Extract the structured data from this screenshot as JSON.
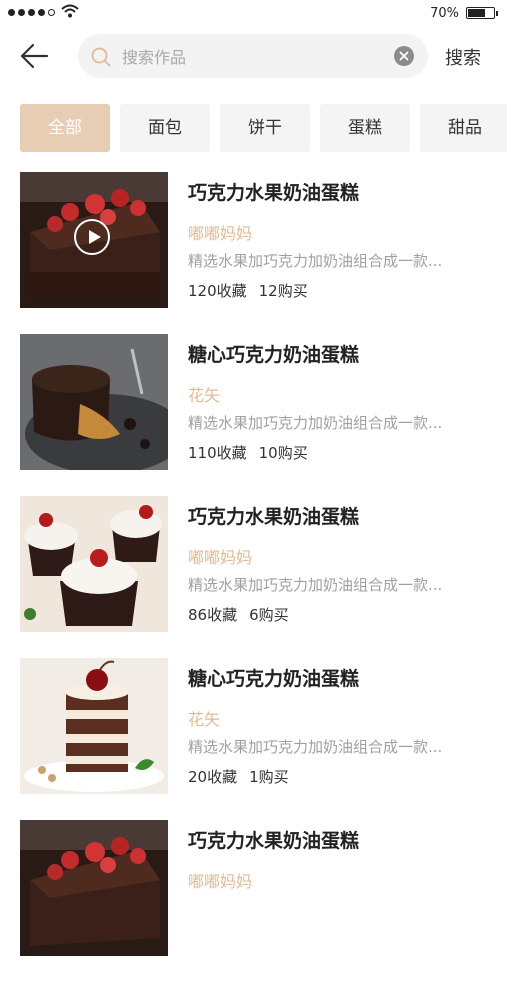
{
  "status_bar": {
    "battery_text": "70%",
    "battery_level": 0.7
  },
  "search": {
    "placeholder": "搜索作品",
    "value": "",
    "button_label": "搜索"
  },
  "tabs": [
    {
      "label": "全部",
      "active": true
    },
    {
      "label": "面包",
      "active": false
    },
    {
      "label": "饼干",
      "active": false
    },
    {
      "label": "蛋糕",
      "active": false
    },
    {
      "label": "甜品",
      "active": false
    }
  ],
  "items": [
    {
      "title": "巧克力水果奶油蛋糕",
      "author": "嘟嘟妈妈",
      "desc": "精选水果加巧克力加奶油组合成一款...",
      "favorites": "120收藏",
      "purchases": "12购买",
      "has_video": true,
      "image": "chocolate-strawberry-loaf"
    },
    {
      "title": "糖心巧克力奶油蛋糕",
      "author": "花矢",
      "desc": "精选水果加巧克力加奶油组合成一款...",
      "favorites": "110收藏",
      "purchases": "10购买",
      "has_video": false,
      "image": "lava-cake"
    },
    {
      "title": "巧克力水果奶油蛋糕",
      "author": "嘟嘟妈妈",
      "desc": "精选水果加巧克力加奶油组合成一款...",
      "favorites": "86收藏",
      "purchases": "6购买",
      "has_video": false,
      "image": "cherry-cupcakes"
    },
    {
      "title": "糖心巧克力奶油蛋糕",
      "author": "花矢",
      "desc": "精选水果加巧克力加奶油组合成一款...",
      "favorites": "20收藏",
      "purchases": "1购买",
      "has_video": false,
      "image": "layer-cake-cherry"
    },
    {
      "title": "巧克力水果奶油蛋糕",
      "author": "嘟嘟妈妈",
      "desc": "精选水果加巧克力加奶油组合成一款...",
      "favorites": "",
      "purchases": "",
      "has_video": false,
      "image": "chocolate-strawberry-loaf"
    }
  ],
  "colors": {
    "accent": "#e6cdb4",
    "author": "#e2bb94",
    "desc": "#a0a0a0"
  }
}
